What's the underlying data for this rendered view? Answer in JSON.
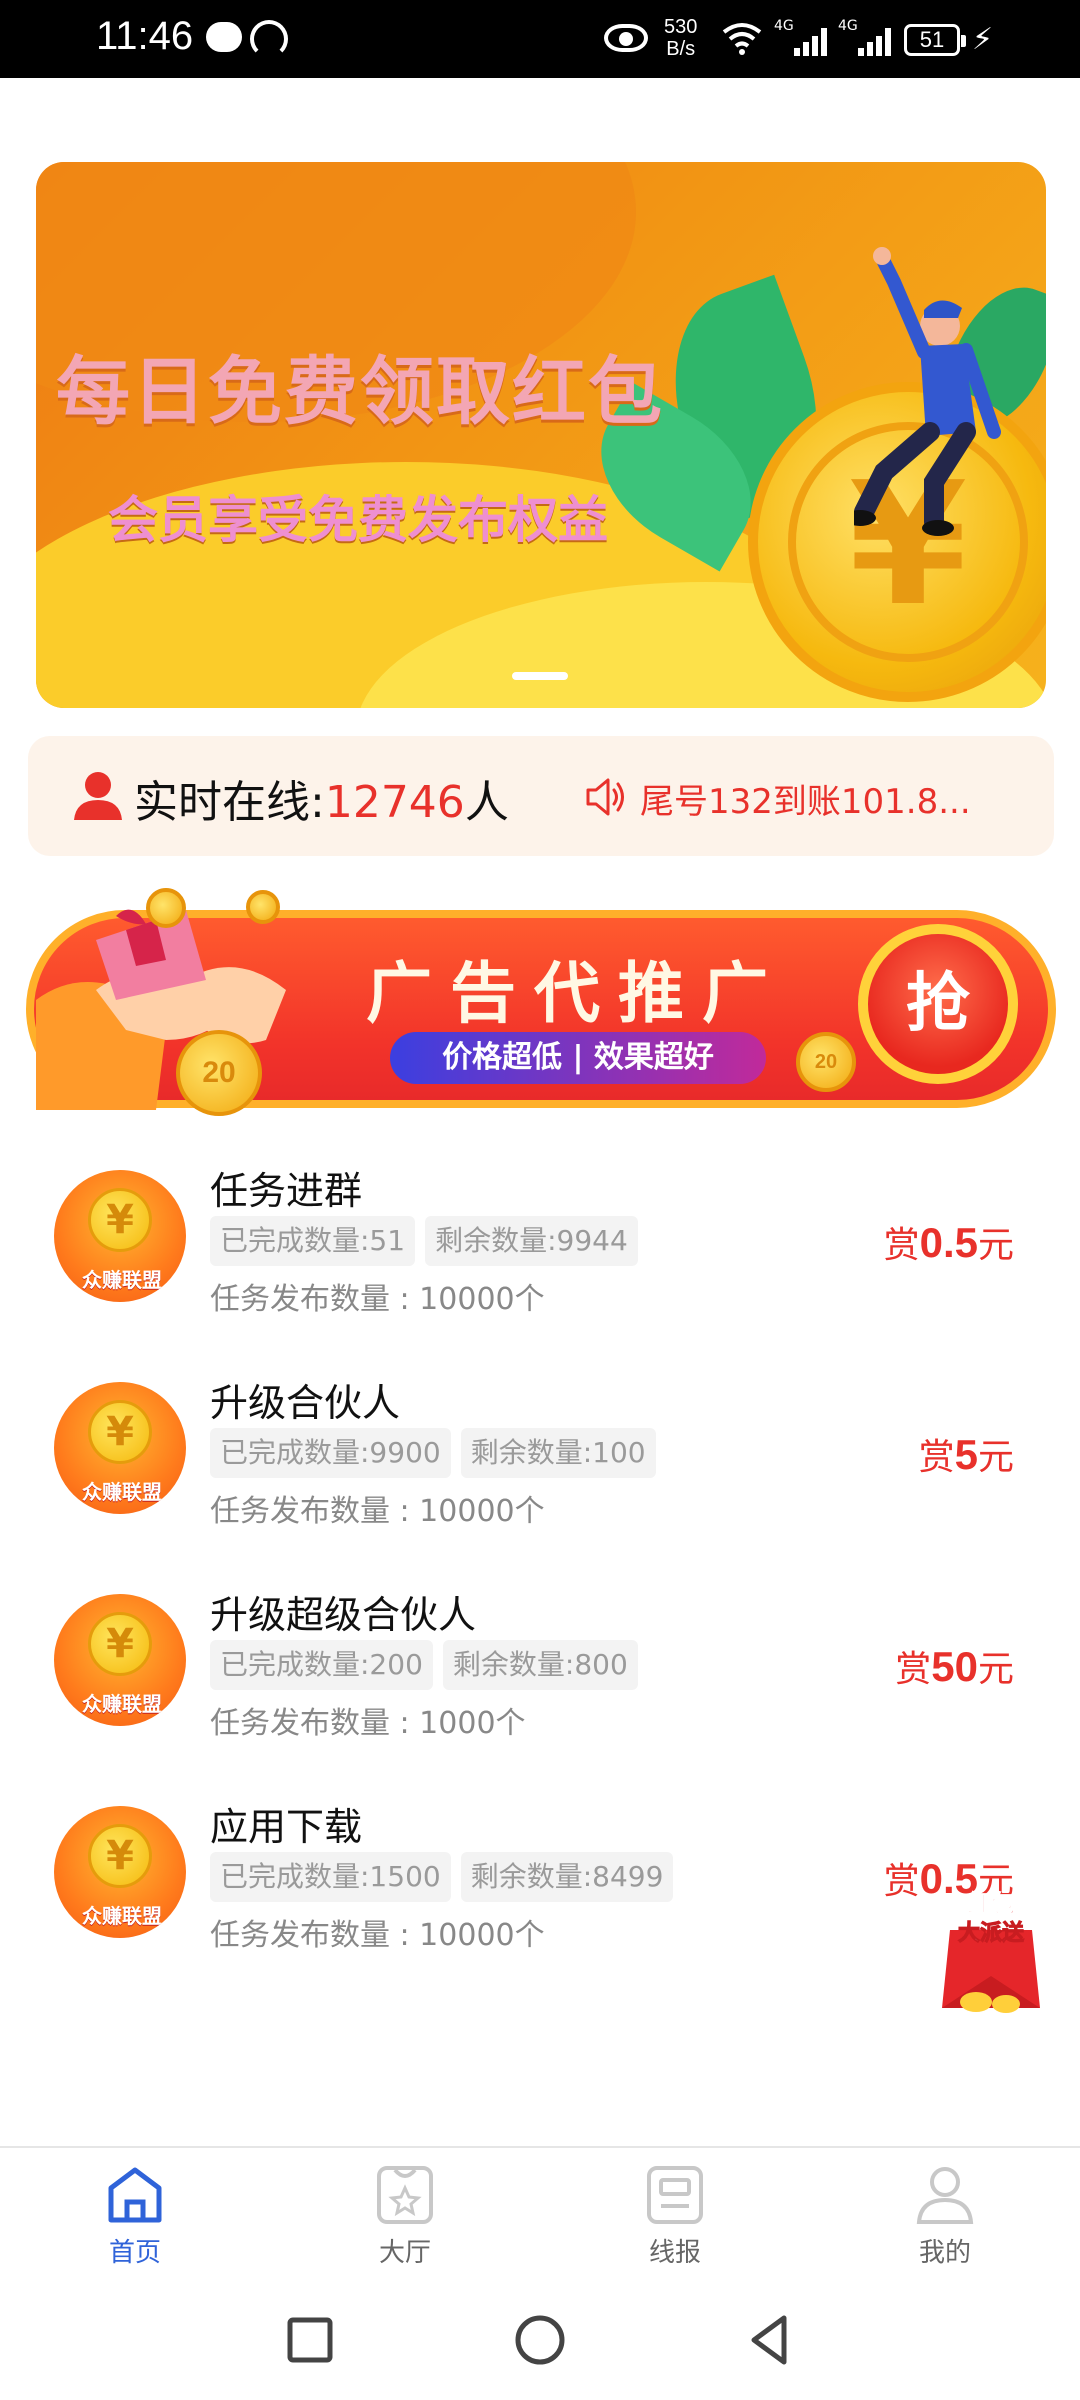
{
  "status_bar": {
    "time": "11:46",
    "net_speed_value": "530",
    "net_speed_unit": "B/s",
    "network_label_1": "4G",
    "network_label_2": "4G",
    "battery": "51"
  },
  "banner": {
    "title": "每日免费领取红包",
    "subtitle": "会员享受免费发布权益",
    "coin_symbol": "¥"
  },
  "online": {
    "label": "实时在线:",
    "count": "12746",
    "unit": "人",
    "marquee": "尾号132到账101.8..."
  },
  "ad_banner": {
    "title": "广告代推广",
    "subtitle": "价格超低 | 效果超好",
    "grab_label": "抢",
    "coin_label": "20"
  },
  "tasks": [
    {
      "title": "任务进群",
      "completed": "已完成数量:51",
      "remaining": "剩余数量:9944",
      "total": "任务发布数量 : 10000个",
      "reward_prefix": "赏",
      "reward_value": "0.5",
      "reward_unit": "元",
      "logo_text": "众赚联盟"
    },
    {
      "title": "升级合伙人",
      "completed": "已完成数量:9900",
      "remaining": "剩余数量:100",
      "total": "任务发布数量 : 10000个",
      "reward_prefix": "赏",
      "reward_value": "5",
      "reward_unit": "元",
      "logo_text": "众赚联盟"
    },
    {
      "title": "升级超级合伙人",
      "completed": "已完成数量:200",
      "remaining": "剩余数量:800",
      "total": "任务发布数量 : 1000个",
      "reward_prefix": "赏",
      "reward_value": "50",
      "reward_unit": "元",
      "logo_text": "众赚联盟"
    },
    {
      "title": "应用下载",
      "completed": "已完成数量:1500",
      "remaining": "剩余数量:8499",
      "total": "任务发布数量 : 10000个",
      "reward_prefix": "赏",
      "reward_value": "0.5",
      "reward_unit": "元",
      "logo_text": "众赚联盟"
    }
  ],
  "float_packet": {
    "line1": "红包",
    "line2": "大派送"
  },
  "tab_bar": {
    "tabs": [
      {
        "label": "首页",
        "icon": "home-icon",
        "active": true
      },
      {
        "label": "大厅",
        "icon": "hall-icon",
        "active": false
      },
      {
        "label": "线报",
        "icon": "news-icon",
        "active": false
      },
      {
        "label": "我的",
        "icon": "profile-icon",
        "active": false
      }
    ]
  },
  "colors": {
    "accent_red": "#e8312b",
    "tab_active": "#2f63d9",
    "banner_orange": "#f29614"
  }
}
